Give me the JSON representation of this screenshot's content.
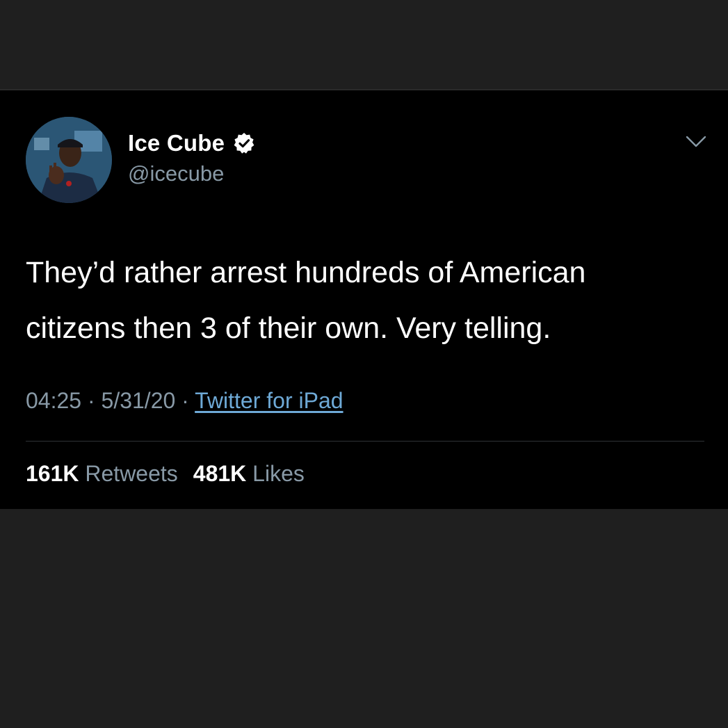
{
  "tweet": {
    "display_name": "Ice Cube",
    "handle": "@icecube",
    "text": "They’d rather arrest hundreds of American\ncitizens then 3 of their own.  Very telling.",
    "time": "04:25",
    "separator": "·",
    "date": "5/31/20",
    "source": "Twitter for iPad",
    "retweets_count": "161K",
    "retweets_label": "Retweets",
    "likes_count": "481K",
    "likes_label": "Likes"
  },
  "icons": {
    "verified": "verified-badge-icon",
    "menu": "chevron-down-icon",
    "avatar": "profile-avatar"
  },
  "colors": {
    "background": "#1f1f1f",
    "card": "#000000",
    "secondary_text": "#8899a6",
    "link": "#6ea9d6"
  }
}
